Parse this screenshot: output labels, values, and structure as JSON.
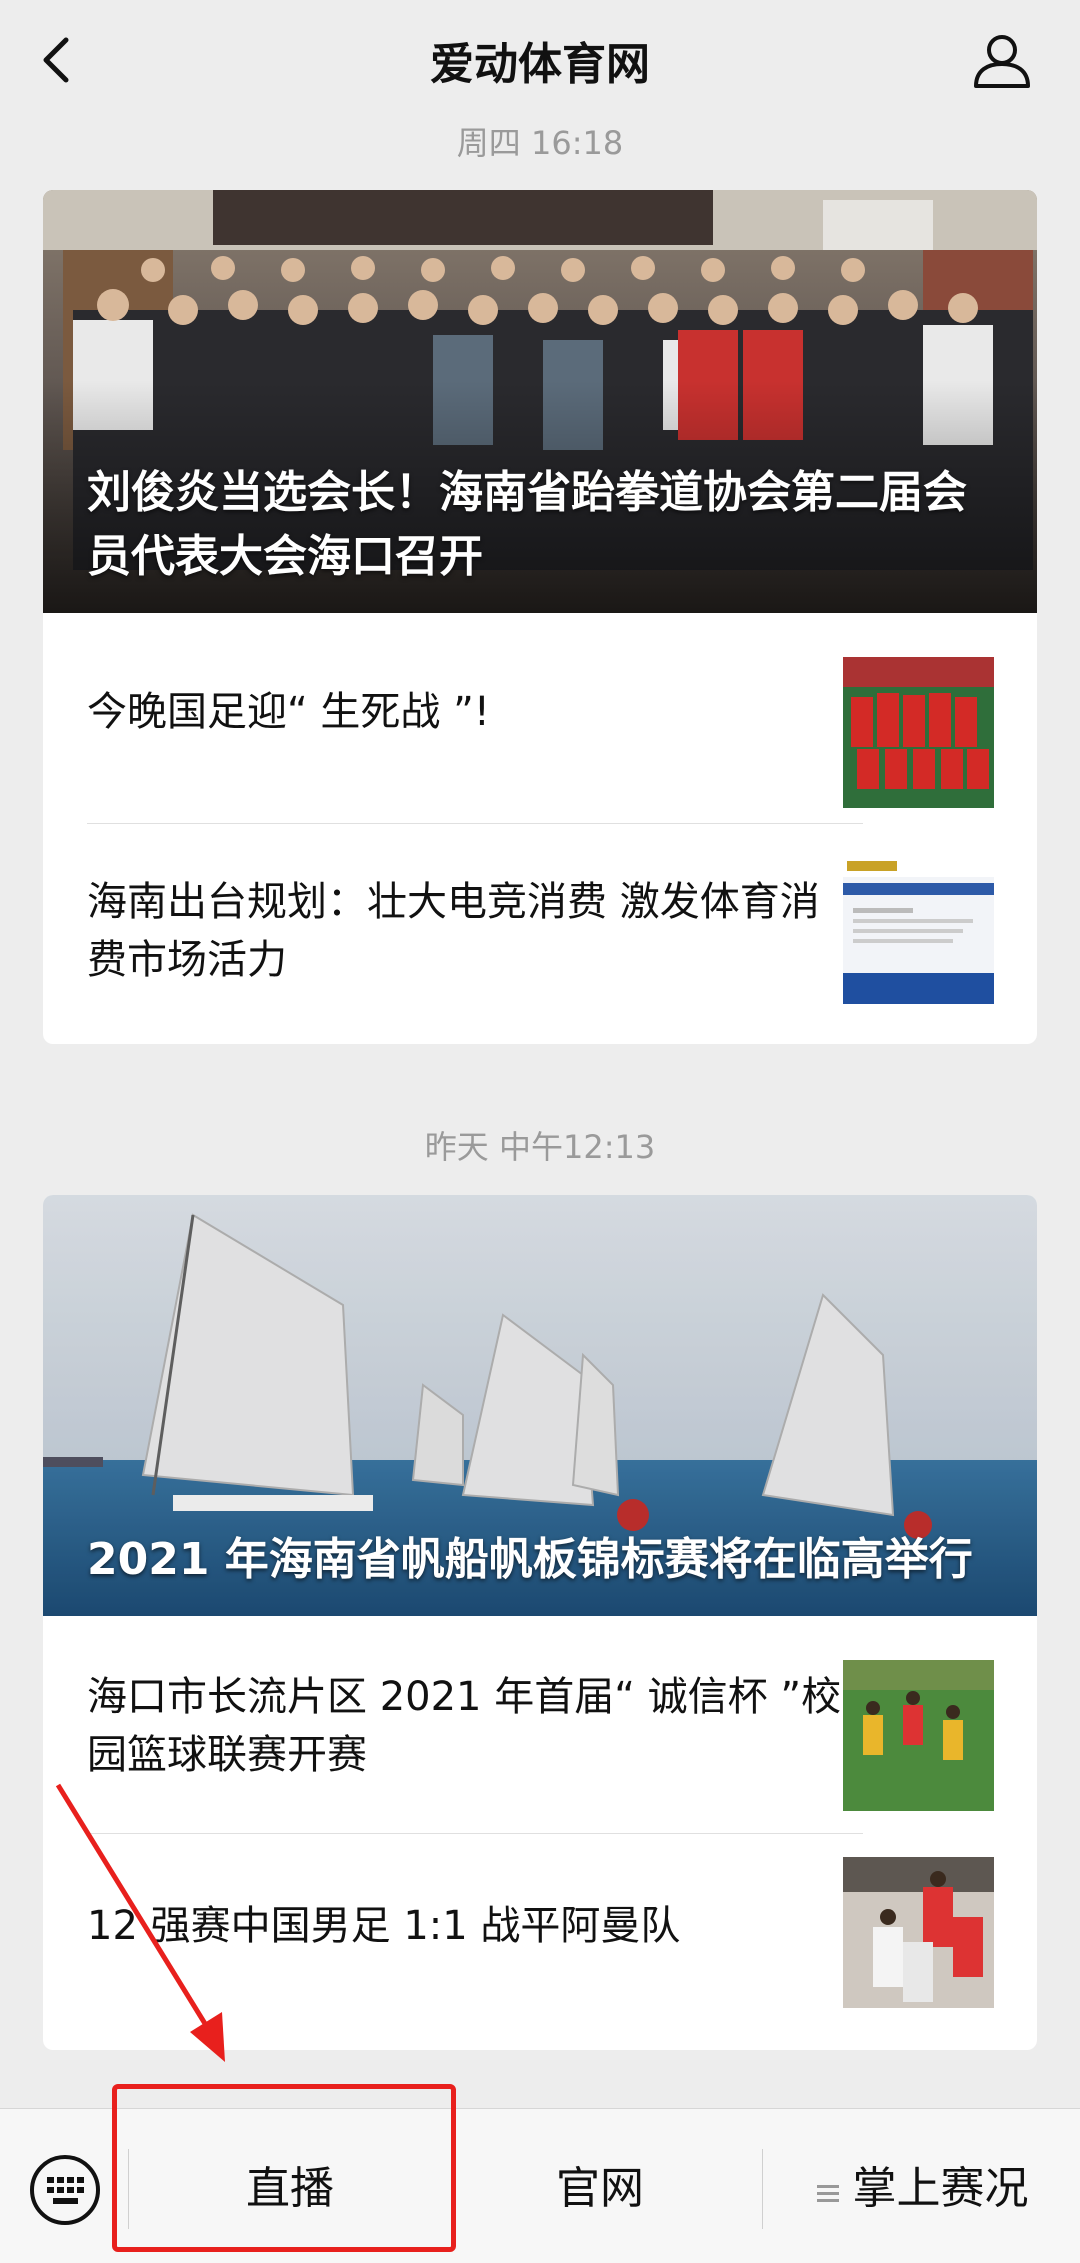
{
  "header": {
    "title": "爱动体育网",
    "back_icon": "chevron-left-icon",
    "profile_icon": "person-icon"
  },
  "groups": [
    {
      "timestamp": "周四 16:18",
      "hero": {
        "title": "刘俊炎当选会长！海南省跆拳道协会第二届会员代表大会海口召开"
      },
      "items": [
        {
          "title": "今晚国足迎“ 生死战 ”!"
        },
        {
          "title": "海南出台规划：壮大电竞消费 激发体育消费市场活力"
        }
      ]
    },
    {
      "timestamp": "昨天 中午12:13",
      "hero": {
        "title": "2021 年海南省帆船帆板锦标赛将在临高举行"
      },
      "items": [
        {
          "title": "海口市长流片区 2021 年首届“ 诚信杯 ”校园篮球联赛开赛"
        },
        {
          "title": "12 强赛中国男足 1:1 战平阿曼队"
        }
      ]
    }
  ],
  "bottom_menu": {
    "keyboard_icon": "keyboard-icon",
    "tabs": [
      {
        "label": "直播"
      },
      {
        "label": "官网"
      },
      {
        "label": "掌上赛况",
        "icon": "menu-icon"
      }
    ]
  },
  "colors": {
    "background": "#ededed",
    "highlight": "#e8201d"
  }
}
